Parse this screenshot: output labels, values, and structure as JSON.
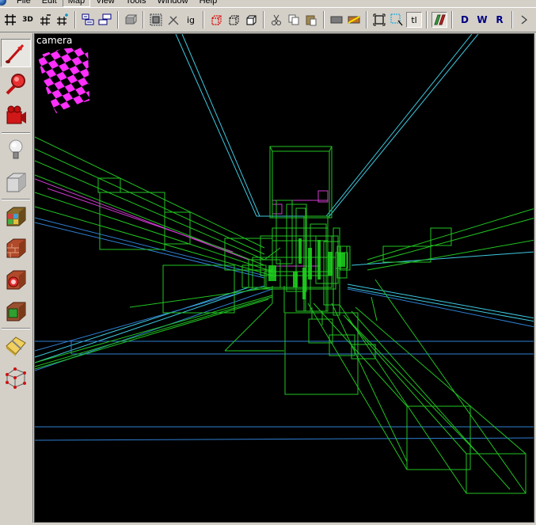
{
  "menu": {
    "items": [
      {
        "label": "File"
      },
      {
        "label": "Edit"
      },
      {
        "label": "Map",
        "active": true
      },
      {
        "label": "View"
      },
      {
        "label": "Tools"
      },
      {
        "label": "Window"
      },
      {
        "label": "Help"
      }
    ]
  },
  "toolbar": {
    "grid3d_label": "3D",
    "ig_label": "ig",
    "tl_label": "tl",
    "d_label": "D",
    "w_label": "W",
    "r_label": "R"
  },
  "palette": {
    "tools": [
      {
        "name": "selection-tool-icon"
      },
      {
        "name": "magnify-tool-icon"
      },
      {
        "name": "camera-tool-icon"
      },
      {
        "name": "entity-tool-icon"
      },
      {
        "name": "block-tool-icon"
      },
      {
        "name": "texture-application-tool-icon"
      },
      {
        "name": "apply-current-texture-tool-icon"
      },
      {
        "name": "decal-tool-icon"
      },
      {
        "name": "overlay-tool-icon"
      },
      {
        "name": "clipping-tool-icon"
      },
      {
        "name": "vertex-manipulation-tool-icon"
      }
    ]
  },
  "viewport": {
    "camera_label": "camera"
  },
  "colors": {
    "chrome": "#d4d0c8",
    "viewport_bg": "#000000",
    "wire_green": "#22c322",
    "wire_blue": "#2f7fd2",
    "wire_cyan": "#3ec9e0",
    "wire_magenta": "#d03ad0"
  }
}
